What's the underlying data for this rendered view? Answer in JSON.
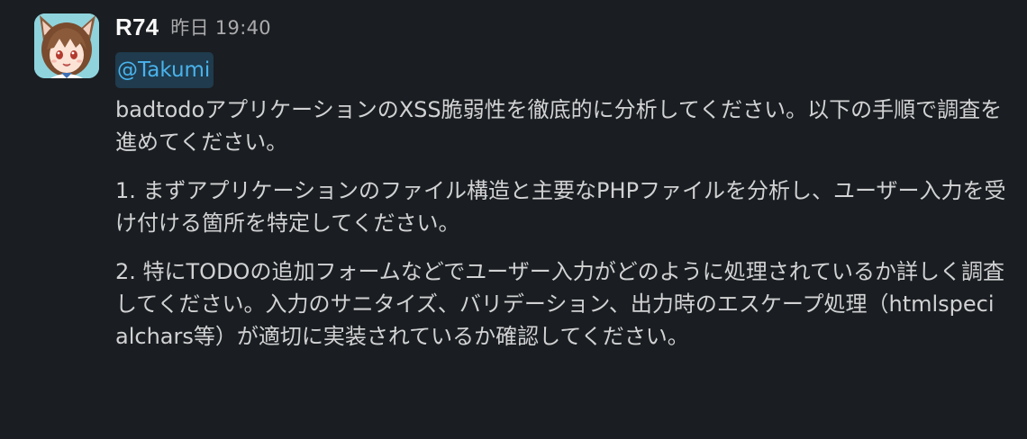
{
  "message": {
    "sender": "R74",
    "timestamp": "昨日 19:40",
    "avatar_icon": "anime-character-avatar",
    "mention": "@Takumi",
    "paragraphs": [
      "badtodoアプリケーションのXSS脆弱性を徹底的に分析してください。以下の手順で調査を進めてください。",
      "1. まずアプリケーションのファイル構造と主要なPHPファイルを分析し、ユーザー入力を受け付ける箇所を特定してください。",
      "2. 特にTODOの追加フォームなどでユーザー入力がどのように処理されているか詳しく調査してください。入力のサニタイズ、バリデーション、出力時のエスケープ処理（htmlspecialchars等）が適切に実装されているか確認してください。"
    ]
  },
  "colors": {
    "background": "#1a1d21",
    "text": "#d1d2d3",
    "sender": "#f8f8f8",
    "timestamp": "#ababad",
    "mention_bg": "#1f3b4d",
    "mention_text": "#4ab3ec"
  }
}
